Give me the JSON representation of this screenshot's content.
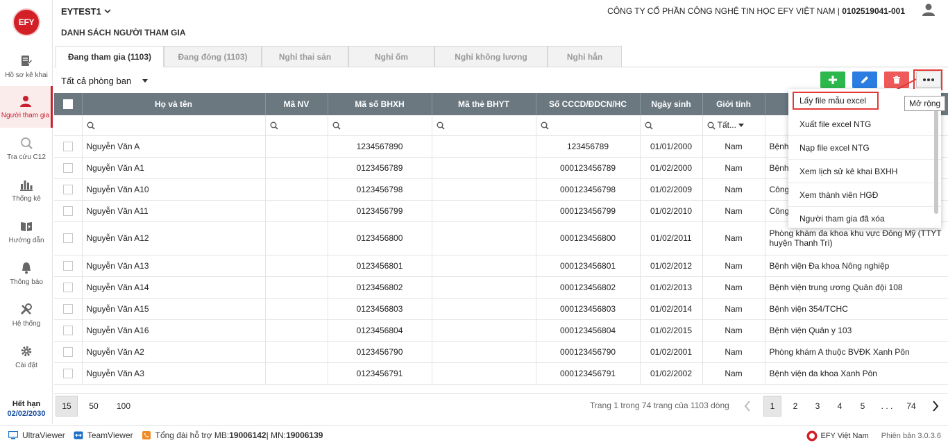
{
  "sidebar": {
    "logo": "EFY",
    "items": [
      {
        "label": "Hồ sơ kê khai",
        "icon": "document-edit-icon"
      },
      {
        "label": "Người tham gia",
        "icon": "user-icon"
      },
      {
        "label": "Tra cứu C12",
        "icon": "search-doc-icon"
      },
      {
        "label": "Thống kê",
        "icon": "bar-chart-icon"
      },
      {
        "label": "Hướng dẫn",
        "icon": "book-play-icon"
      },
      {
        "label": "Thông báo",
        "icon": "bell-icon"
      },
      {
        "label": "Hệ thống",
        "icon": "tools-icon"
      },
      {
        "label": "Cài đặt",
        "icon": "gear-icon"
      }
    ],
    "expire_label": "Hết hạn",
    "expire_date": "02/02/2030"
  },
  "header": {
    "org_code": "EYTEST1",
    "company_name": "CÔNG TY CỔ PHẦN CÔNG NGHỆ TIN HỌC EFY VIỆT NAM | ",
    "tax_code": "0102519041-001"
  },
  "page_title": "DANH SÁCH NGƯỜI THAM GIA",
  "tabs": [
    {
      "label": "Đang tham gia (1103)"
    },
    {
      "label": "Đang đóng (1103)"
    },
    {
      "label": "Nghỉ thai sản"
    },
    {
      "label": "Nghỉ ốm"
    },
    {
      "label": "Nghỉ không lương"
    },
    {
      "label": "Nghỉ hẳn"
    }
  ],
  "department_filter": "Tất cả phòng ban",
  "columns": [
    "Họ và tên",
    "Mã NV",
    "Mã số BHXH",
    "Mã thẻ BHYT",
    "Số CCCD/ĐDCN/HC",
    "Ngày sinh",
    "Giới tính",
    ""
  ],
  "gender_filter": "Tất...",
  "rows": [
    {
      "name": "Nguyễn Văn A",
      "emp": "",
      "bhxh": "1234567890",
      "bhyt": "",
      "cccd": "123456789",
      "dob": "01/01/2000",
      "gender": "Nam",
      "hospital": "Bệnh"
    },
    {
      "name": "Nguyễn Văn A1",
      "emp": "",
      "bhxh": "0123456789",
      "bhyt": "",
      "cccd": "000123456789",
      "dob": "01/02/2000",
      "gender": "Nam",
      "hospital": "Bệnh"
    },
    {
      "name": "Nguyễn Văn A10",
      "emp": "",
      "bhxh": "0123456798",
      "bhyt": "",
      "cccd": "000123456798",
      "dob": "01/02/2009",
      "gender": "Nam",
      "hospital": "Công"
    },
    {
      "name": "Nguyễn Văn A11",
      "emp": "",
      "bhxh": "0123456799",
      "bhyt": "",
      "cccd": "000123456799",
      "dob": "01/02/2010",
      "gender": "Nam",
      "hospital": "Công"
    },
    {
      "name": "Nguyễn Văn A12",
      "emp": "",
      "bhxh": "0123456800",
      "bhyt": "",
      "cccd": "000123456800",
      "dob": "01/02/2011",
      "gender": "Nam",
      "hospital": "Phòng khám đa khoa khu vực Đông Mỹ (TTYT huyện Thanh Trì)"
    },
    {
      "name": "Nguyễn Văn A13",
      "emp": "",
      "bhxh": "0123456801",
      "bhyt": "",
      "cccd": "000123456801",
      "dob": "01/02/2012",
      "gender": "Nam",
      "hospital": "Bệnh viện Đa khoa Nông nghiệp"
    },
    {
      "name": "Nguyễn Văn A14",
      "emp": "",
      "bhxh": "0123456802",
      "bhyt": "",
      "cccd": "000123456802",
      "dob": "01/02/2013",
      "gender": "Nam",
      "hospital": "Bệnh viện trung ương Quân đội 108"
    },
    {
      "name": "Nguyễn Văn A15",
      "emp": "",
      "bhxh": "0123456803",
      "bhyt": "",
      "cccd": "000123456803",
      "dob": "01/02/2014",
      "gender": "Nam",
      "hospital": "Bệnh viện 354/TCHC"
    },
    {
      "name": "Nguyễn Văn A16",
      "emp": "",
      "bhxh": "0123456804",
      "bhyt": "",
      "cccd": "000123456804",
      "dob": "01/02/2015",
      "gender": "Nam",
      "hospital": "Bệnh viện Quân y 103"
    },
    {
      "name": "Nguyễn Văn A2",
      "emp": "",
      "bhxh": "0123456790",
      "bhyt": "",
      "cccd": "000123456790",
      "dob": "01/02/2001",
      "gender": "Nam",
      "hospital": "Phòng khám A thuộc BVĐK Xanh Pôn"
    },
    {
      "name": "Nguyễn Văn A3",
      "emp": "",
      "bhxh": "0123456791",
      "bhyt": "",
      "cccd": "000123456791",
      "dob": "01/02/2002",
      "gender": "Nam",
      "hospital": "Bệnh viện đa khoa Xanh Pôn"
    }
  ],
  "menu": {
    "items": [
      "Lấy file mẫu excel",
      "Xuất file excel NTG",
      "Nạp file excel NTG",
      "Xem lịch sử kê khai BXHH",
      "Xem thành viên HGĐ",
      "Người tham gia đã xóa"
    ],
    "tooltip": "Mở rộng"
  },
  "pager": {
    "sizes": [
      "15",
      "50",
      "100"
    ],
    "info": "Trang 1 trong 74 trang của 1103 dòng",
    "pages": [
      "1",
      "2",
      "3",
      "4",
      "5",
      ". . .",
      "74"
    ]
  },
  "footer": {
    "ultraviewer": "UltraViewer",
    "teamviewer": "TeamViewer",
    "hotline_label": "Tổng đài hỗ trợ MB: ",
    "hotline_mb": "19006142",
    "hotline_sep": " | MN: ",
    "hotline_mn": "19006139",
    "brand": "EFY Việt Nam",
    "version": "Phiên bản 3.0.3.6"
  },
  "colors": {
    "accent": "#c8202d",
    "add": "#2db84d",
    "edit": "#2b7de1",
    "delete": "#ee5a5a",
    "header_bg": "#6b7880"
  }
}
